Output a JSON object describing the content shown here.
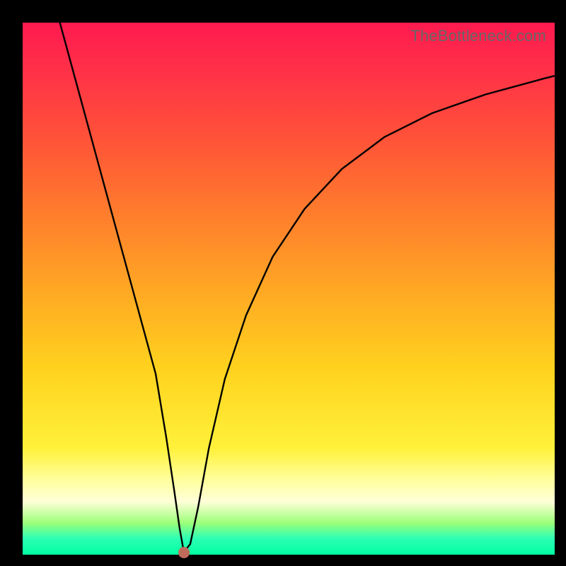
{
  "watermark": "TheBottleneck.com",
  "chart_data": {
    "type": "line",
    "title": "",
    "xlabel": "",
    "ylabel": "",
    "xlim": [
      0,
      100
    ],
    "ylim": [
      0,
      100
    ],
    "series": [
      {
        "name": "curve",
        "x": [
          7,
          10,
          13,
          16,
          19,
          22,
          25,
          27,
          28.5,
          29.5,
          30.3,
          31.5,
          33,
          35,
          38,
          42,
          47,
          53,
          60,
          68,
          77,
          87,
          98,
          100
        ],
        "values": [
          100,
          89,
          78,
          67,
          56,
          45,
          34,
          22,
          12,
          5,
          0.5,
          2,
          9,
          20,
          33,
          45,
          56,
          65,
          72.5,
          78.5,
          83,
          86.5,
          89.5,
          90
        ]
      }
    ],
    "marker": {
      "x": 30.3,
      "y": 0.4
    },
    "gradient_stops": [
      {
        "pos": 0,
        "color": "#ff1a4f"
      },
      {
        "pos": 50,
        "color": "#ffa724"
      },
      {
        "pos": 85,
        "color": "#ffff9e"
      },
      {
        "pos": 100,
        "color": "#00ffa0"
      }
    ]
  }
}
